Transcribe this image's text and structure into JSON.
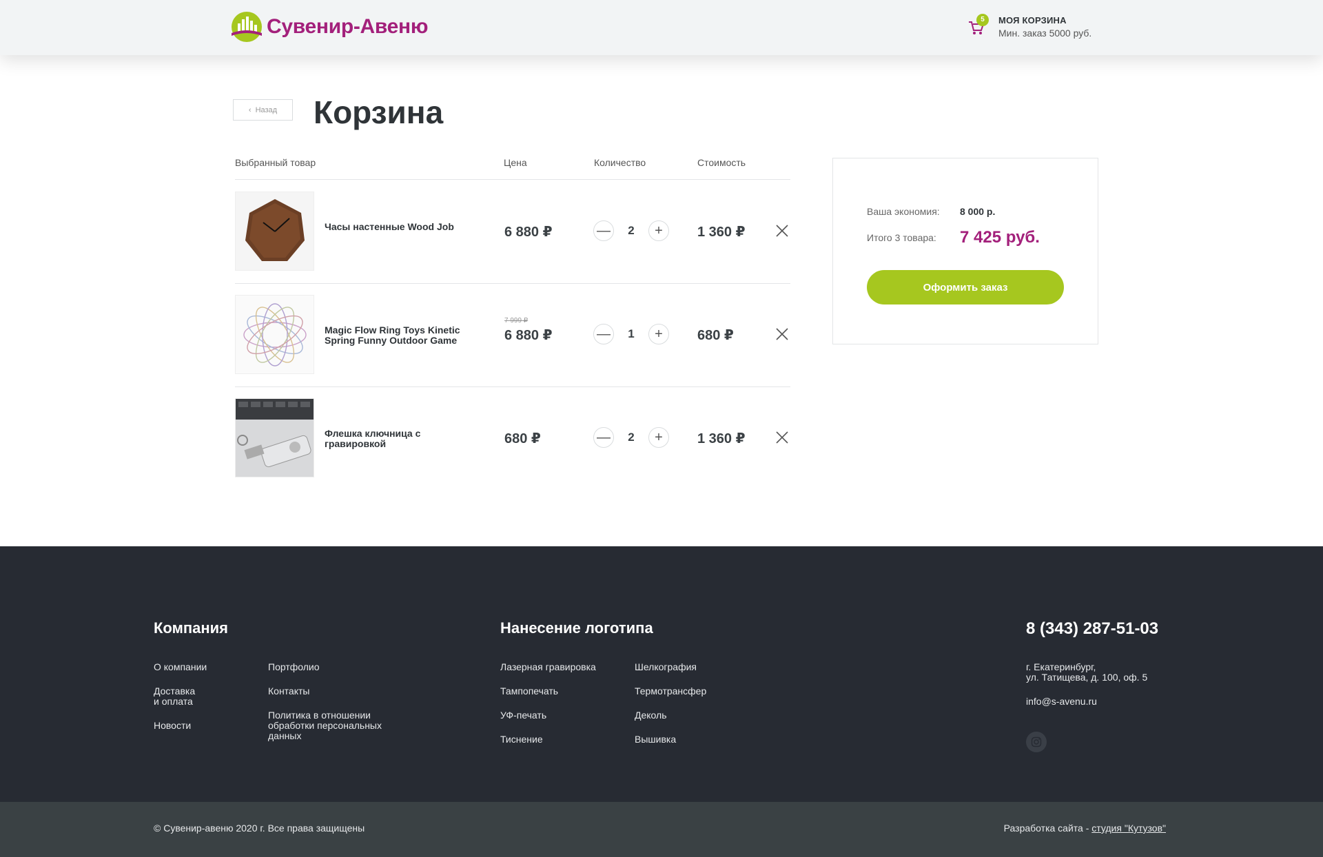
{
  "header": {
    "logo_text": "Сувенир-Авеню",
    "cart_count": "5",
    "cart_title": "МОЯ КОРЗИНА",
    "cart_subtitle": "Мин. заказ 5000 руб."
  },
  "page": {
    "back_label": "Назад",
    "title": "Корзина"
  },
  "table": {
    "columns": [
      "Выбранный товар",
      "Цена",
      "Количество",
      "Стоимость"
    ],
    "rows": [
      {
        "name": "Часы настенные Wood Job",
        "old_price": "",
        "price": "6 880 ₽",
        "qty": "2",
        "cost": "1 360 ₽"
      },
      {
        "name": "Magic Flow Ring Toys Kinetic Spring Funny Outdoor Game",
        "old_price": "7 999 ₽",
        "price": "6 880 ₽",
        "qty": "1",
        "cost": "680 ₽"
      },
      {
        "name": "Флешка ключница с гравировкой",
        "old_price": "",
        "price": "680 ₽",
        "qty": "2",
        "cost": "1 360 ₽"
      }
    ]
  },
  "summary": {
    "economy_label": "Ваша экономия:",
    "economy_value": "8 000 р.",
    "total_label": "Итого 3 товара:",
    "total_value": "7 425 руб.",
    "order_button": "Оформить заказ"
  },
  "footer": {
    "company_title": "Компания",
    "company_links_col1": [
      "О компании",
      "Доставка\nи оплата",
      "Новости"
    ],
    "company_links_col2": [
      "Портфолио",
      "Контакты",
      "Политика в отношении\nобработки персональных\nданных"
    ],
    "logo_title": "Нанесение логотипа",
    "logo_links_col1": [
      "Лазерная гравировка",
      "Тампопечать",
      "УФ-печать",
      "Тиснение"
    ],
    "logo_links_col2": [
      "Шелкография",
      "Термотрансфер",
      "Деколь",
      "Вышивка"
    ],
    "phone": "8 (343) 287-51-03",
    "address": "г. Екатеринбург,\nул. Татищева, д. 100, оф. 5",
    "email": "info@s-avenu.ru",
    "copyright": "© Сувенир-авеню 2020 г.  Все права защищены",
    "dev_prefix": "Разработка сайта - ",
    "dev_link": "студия \"Кутузов\""
  },
  "colors": {
    "accent_green": "#a6c71f",
    "brand_purple": "#a3207b",
    "footer_bg": "#272b33",
    "bottom_bar_bg": "#3a4144"
  }
}
